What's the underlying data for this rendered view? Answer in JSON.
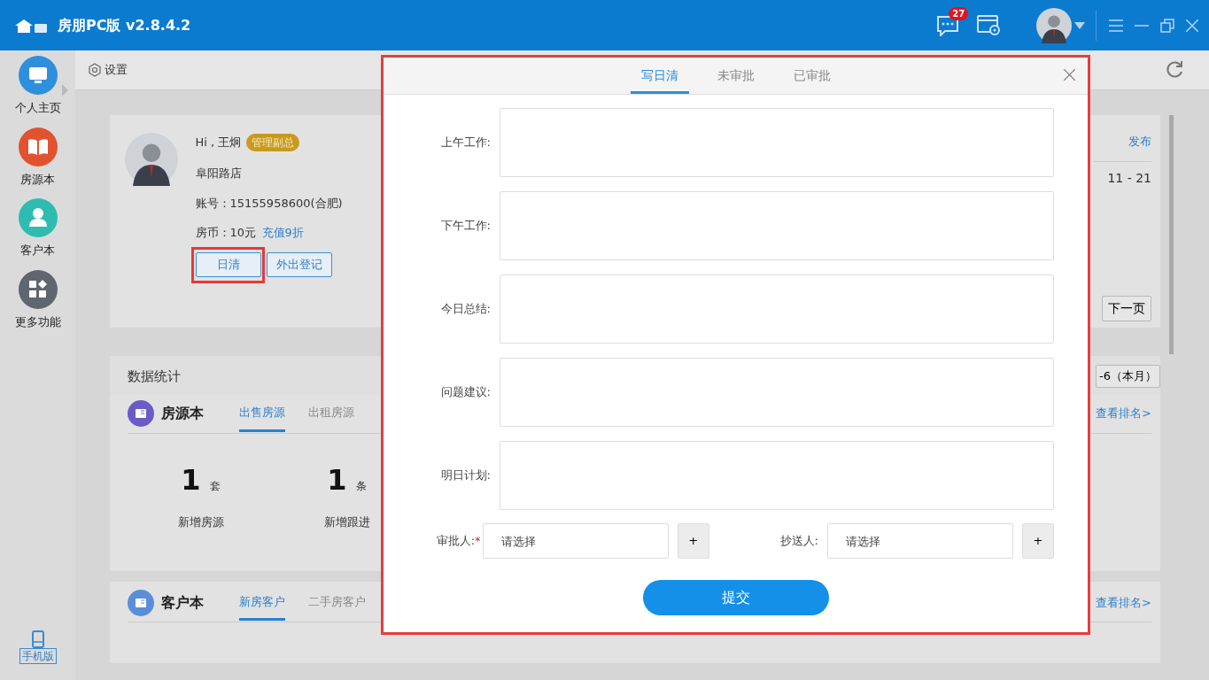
{
  "app": {
    "title": "房朋PC版 v2.8.4.2",
    "notification_count": "27"
  },
  "sidebar": {
    "items": [
      {
        "label": "个人主页",
        "selected": true,
        "color": "#2f8fdc",
        "kind": "monitor"
      },
      {
        "label": "房源本",
        "selected": false,
        "color": "#e0532e",
        "kind": "book"
      },
      {
        "label": "客户本",
        "selected": false,
        "color": "#2fbcb0",
        "kind": "people"
      },
      {
        "label": "更多功能",
        "selected": false,
        "color": "#5f6670",
        "kind": "apps"
      }
    ],
    "mobile_label": "手机版"
  },
  "toolbar": {
    "settings_label": "设置"
  },
  "profile": {
    "greeting": "Hi , 王炯",
    "role_badge": "管理副总",
    "store": "阜阳路店",
    "account": "账号：15155958600(合肥)",
    "coins": "房币：10元",
    "recharge_link": "充值9折",
    "buttons": [
      {
        "label": "日清",
        "highlighted": true
      },
      {
        "label": "外出登记",
        "highlighted": false
      }
    ],
    "publish_link": "发布",
    "date_range": "11 - 21",
    "next_page": "下一页"
  },
  "stats": {
    "title": "数据统计",
    "period_button": "-6（本月）",
    "sections": [
      {
        "title": "房源本",
        "color": "#6a5cc4",
        "tabs": [
          {
            "label": "出售房源",
            "selected": true
          },
          {
            "label": "出租房源",
            "selected": false
          }
        ],
        "rank_link": "查看排名>",
        "metrics": [
          {
            "value": "1",
            "unit": "套",
            "label": "新增房源"
          },
          {
            "value": "1",
            "unit": "条",
            "label": "新增跟进"
          }
        ]
      },
      {
        "title": "客户本",
        "color": "#5a8fd8",
        "tabs": [
          {
            "label": "新房客户",
            "selected": true
          },
          {
            "label": "二手房客户",
            "selected": false
          }
        ],
        "rank_link": "查看排名>"
      }
    ]
  },
  "dialog": {
    "tabs": [
      {
        "label": "写日清",
        "selected": true
      },
      {
        "label": "未审批",
        "selected": false
      },
      {
        "label": "已审批",
        "selected": false
      }
    ],
    "fields": [
      {
        "label": "上午工作:"
      },
      {
        "label": "下午工作:"
      },
      {
        "label": "今日总结:"
      },
      {
        "label": "问题建议:"
      },
      {
        "label": "明日计划:"
      }
    ],
    "pickers": [
      {
        "label": "审批人:",
        "required_mark": "*",
        "placeholder": "请选择",
        "add": "+"
      },
      {
        "label": "抄送人:",
        "placeholder": "请选择",
        "add": "+"
      }
    ],
    "submit": "提交"
  }
}
